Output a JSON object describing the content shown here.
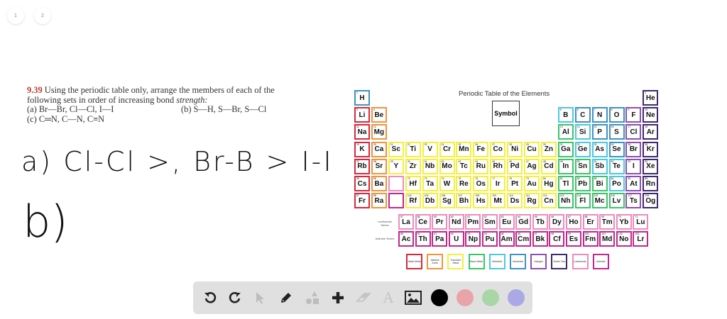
{
  "pages": [
    "1",
    "2"
  ],
  "problem": {
    "number": "9.39",
    "text": "Using the periodic table only, arrange the members of each of the following sets in order of increasing bond",
    "emph": "strength:",
    "a": "(a) Br—Br, Cl—Cl, I—I",
    "b": "(b) S—H, S—Br, S—Cl",
    "c": "(c) C═N, C—N, C≡N"
  },
  "handwriting": {
    "a": "a) Cl-Cl >, Br-B > I-I",
    "b": "b)"
  },
  "periodic_table": {
    "title": "Periodic Table of the Elements",
    "key_symbol": "Symbol",
    "lanthanide_label": "Lanthanide Series",
    "actinide_label": "Actinide Series",
    "colors": {
      "alkali": "#d9283c",
      "alkaline": "#f0953a",
      "transition": "#f3f03c",
      "basic": "#3cc46a",
      "metalloid": "#4cc8e0",
      "nonmetal": "#3d93c4",
      "halogen": "#8c4fb0",
      "noble": "#3e2a6e",
      "lanthanide": "#ec8cbc",
      "actinide": "#c4268f"
    },
    "elements": [
      [
        "H",
        1,
        1,
        1,
        "nonmetal"
      ],
      [
        "He",
        2,
        18,
        1,
        "noble"
      ],
      [
        "Li",
        3,
        1,
        2,
        "alkali"
      ],
      [
        "Be",
        4,
        2,
        2,
        "alkaline"
      ],
      [
        "B",
        5,
        13,
        2,
        "metalloid"
      ],
      [
        "C",
        6,
        14,
        2,
        "nonmetal"
      ],
      [
        "N",
        7,
        15,
        2,
        "nonmetal"
      ],
      [
        "O",
        8,
        16,
        2,
        "nonmetal"
      ],
      [
        "F",
        9,
        17,
        2,
        "halogen"
      ],
      [
        "Ne",
        10,
        18,
        2,
        "noble"
      ],
      [
        "Na",
        11,
        1,
        3,
        "alkali"
      ],
      [
        "Mg",
        12,
        2,
        3,
        "alkaline"
      ],
      [
        "Al",
        13,
        13,
        3,
        "basic"
      ],
      [
        "Si",
        14,
        14,
        3,
        "metalloid"
      ],
      [
        "P",
        15,
        15,
        3,
        "nonmetal"
      ],
      [
        "S",
        16,
        16,
        3,
        "nonmetal"
      ],
      [
        "Cl",
        17,
        17,
        3,
        "halogen"
      ],
      [
        "Ar",
        18,
        18,
        3,
        "noble"
      ],
      [
        "K",
        19,
        1,
        4,
        "alkali"
      ],
      [
        "Ca",
        20,
        2,
        4,
        "alkaline"
      ],
      [
        "Sc",
        21,
        3,
        4,
        "transition"
      ],
      [
        "Ti",
        22,
        4,
        4,
        "transition"
      ],
      [
        "V",
        23,
        5,
        4,
        "transition"
      ],
      [
        "Cr",
        24,
        6,
        4,
        "transition"
      ],
      [
        "Mn",
        25,
        7,
        4,
        "transition"
      ],
      [
        "Fe",
        26,
        8,
        4,
        "transition"
      ],
      [
        "Co",
        27,
        9,
        4,
        "transition"
      ],
      [
        "Ni",
        28,
        10,
        4,
        "transition"
      ],
      [
        "Cu",
        29,
        11,
        4,
        "transition"
      ],
      [
        "Zn",
        30,
        12,
        4,
        "transition"
      ],
      [
        "Ga",
        31,
        13,
        4,
        "basic"
      ],
      [
        "Ge",
        32,
        14,
        4,
        "metalloid"
      ],
      [
        "As",
        33,
        15,
        4,
        "metalloid"
      ],
      [
        "Se",
        34,
        16,
        4,
        "nonmetal"
      ],
      [
        "Br",
        35,
        17,
        4,
        "halogen"
      ],
      [
        "Kr",
        36,
        18,
        4,
        "noble"
      ],
      [
        "Rb",
        37,
        1,
        5,
        "alkali"
      ],
      [
        "Sr",
        38,
        2,
        5,
        "alkaline"
      ],
      [
        "Y",
        39,
        3,
        5,
        "transition"
      ],
      [
        "Zr",
        40,
        4,
        5,
        "transition"
      ],
      [
        "Nb",
        41,
        5,
        5,
        "transition"
      ],
      [
        "Mo",
        42,
        6,
        5,
        "transition"
      ],
      [
        "Tc",
        43,
        7,
        5,
        "transition"
      ],
      [
        "Ru",
        44,
        8,
        5,
        "transition"
      ],
      [
        "Rh",
        45,
        9,
        5,
        "transition"
      ],
      [
        "Pd",
        46,
        10,
        5,
        "transition"
      ],
      [
        "Ag",
        47,
        11,
        5,
        "transition"
      ],
      [
        "Cd",
        48,
        12,
        5,
        "transition"
      ],
      [
        "In",
        49,
        13,
        5,
        "basic"
      ],
      [
        "Sn",
        50,
        14,
        5,
        "basic"
      ],
      [
        "Sb",
        51,
        15,
        5,
        "metalloid"
      ],
      [
        "Te",
        52,
        16,
        5,
        "metalloid"
      ],
      [
        "I",
        53,
        17,
        5,
        "halogen"
      ],
      [
        "Xe",
        54,
        18,
        5,
        "noble"
      ],
      [
        "Cs",
        55,
        1,
        6,
        "alkali"
      ],
      [
        "Ba",
        56,
        2,
        6,
        "alkaline"
      ],
      [
        "",
        null,
        3,
        6,
        "lanthanide"
      ],
      [
        "Hf",
        72,
        4,
        6,
        "transition"
      ],
      [
        "Ta",
        73,
        5,
        6,
        "transition"
      ],
      [
        "W",
        74,
        6,
        6,
        "transition"
      ],
      [
        "Re",
        75,
        7,
        6,
        "transition"
      ],
      [
        "Os",
        76,
        8,
        6,
        "transition"
      ],
      [
        "Ir",
        77,
        9,
        6,
        "transition"
      ],
      [
        "Pt",
        78,
        10,
        6,
        "transition"
      ],
      [
        "Au",
        79,
        11,
        6,
        "transition"
      ],
      [
        "Hg",
        80,
        12,
        6,
        "transition"
      ],
      [
        "Tl",
        81,
        13,
        6,
        "basic"
      ],
      [
        "Pb",
        82,
        14,
        6,
        "basic"
      ],
      [
        "Bi",
        83,
        15,
        6,
        "basic"
      ],
      [
        "Po",
        84,
        16,
        6,
        "metalloid"
      ],
      [
        "At",
        85,
        17,
        6,
        "halogen"
      ],
      [
        "Rn",
        86,
        18,
        6,
        "noble"
      ],
      [
        "Fr",
        87,
        1,
        7,
        "alkali"
      ],
      [
        "Ra",
        88,
        2,
        7,
        "alkaline"
      ],
      [
        "",
        null,
        3,
        7,
        "actinide"
      ],
      [
        "Rf",
        104,
        4,
        7,
        "transition"
      ],
      [
        "Db",
        105,
        5,
        7,
        "transition"
      ],
      [
        "Sg",
        106,
        6,
        7,
        "transition"
      ],
      [
        "Bh",
        107,
        7,
        7,
        "transition"
      ],
      [
        "Hs",
        108,
        8,
        7,
        "transition"
      ],
      [
        "Mt",
        109,
        9,
        7,
        "transition"
      ],
      [
        "Ds",
        110,
        10,
        7,
        "transition"
      ],
      [
        "Rg",
        111,
        11,
        7,
        "transition"
      ],
      [
        "Cn",
        112,
        12,
        7,
        "transition"
      ],
      [
        "Nh",
        113,
        13,
        7,
        "basic"
      ],
      [
        "Fl",
        114,
        14,
        7,
        "basic"
      ],
      [
        "Mc",
        115,
        15,
        7,
        "basic"
      ],
      [
        "Lv",
        116,
        16,
        7,
        "basic"
      ],
      [
        "Ts",
        117,
        17,
        7,
        "halogen"
      ],
      [
        "Og",
        118,
        18,
        7,
        "noble"
      ]
    ],
    "lanthanides": [
      "La",
      "Ce",
      "Pr",
      "Nd",
      "Pm",
      "Sm",
      "Eu",
      "Gd",
      "Tb",
      "Dy",
      "Ho",
      "Er",
      "Tm",
      "Yb",
      "Lu"
    ],
    "actinides": [
      "Ac",
      "Th",
      "Pa",
      "U",
      "Np",
      "Pu",
      "Am",
      "Cm",
      "Bk",
      "Cf",
      "Es",
      "Fm",
      "Md",
      "No",
      "Lr"
    ],
    "legend": [
      [
        "Alkali Metal",
        "alkali"
      ],
      [
        "Alkaline Earth",
        "alkaline"
      ],
      [
        "Transition Metal",
        "transition"
      ],
      [
        "Basic Metal",
        "basic"
      ],
      [
        "Metalloid",
        "metalloid"
      ],
      [
        "Nonmetal",
        "nonmetal"
      ],
      [
        "Halogen",
        "halogen"
      ],
      [
        "Noble Gas",
        "noble"
      ],
      [
        "Lanthanide",
        "lanthanide"
      ],
      [
        "Actinide",
        "actinide"
      ]
    ]
  },
  "toolbar": {
    "colors": [
      "#000000",
      "#e8a4a8",
      "#a9d6a7",
      "#aba8e6"
    ]
  }
}
